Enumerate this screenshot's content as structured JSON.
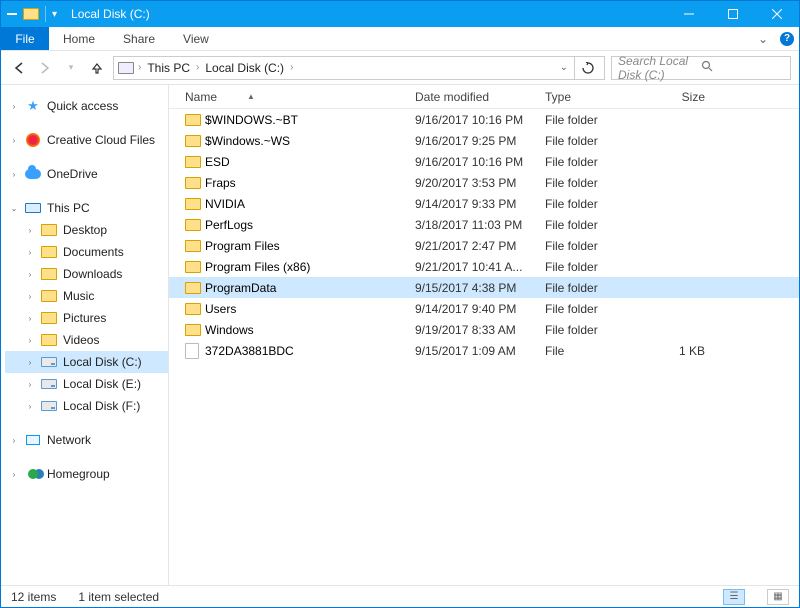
{
  "window": {
    "title": "Local Disk (C:)"
  },
  "ribbon": {
    "file": "File",
    "tabs": [
      "Home",
      "Share",
      "View"
    ]
  },
  "breadcrumb": {
    "root": "This PC",
    "current": "Local Disk (C:)"
  },
  "search": {
    "placeholder": "Search Local Disk (C:)"
  },
  "sidebar": {
    "quick_access": "Quick access",
    "creative_cloud": "Creative Cloud Files",
    "onedrive": "OneDrive",
    "this_pc": "This PC",
    "children": [
      {
        "label": "Desktop"
      },
      {
        "label": "Documents"
      },
      {
        "label": "Downloads"
      },
      {
        "label": "Music"
      },
      {
        "label": "Pictures"
      },
      {
        "label": "Videos"
      },
      {
        "label": "Local Disk (C:)",
        "selected": true
      },
      {
        "label": "Local Disk (E:)"
      },
      {
        "label": "Local Disk (F:)"
      }
    ],
    "network": "Network",
    "homegroup": "Homegroup"
  },
  "columns": {
    "name": "Name",
    "date": "Date modified",
    "type": "Type",
    "size": "Size"
  },
  "rows": [
    {
      "name": "$WINDOWS.~BT",
      "date": "9/16/2017 10:16 PM",
      "type": "File folder",
      "size": "",
      "icon": "folder"
    },
    {
      "name": "$Windows.~WS",
      "date": "9/16/2017 9:25 PM",
      "type": "File folder",
      "size": "",
      "icon": "folder"
    },
    {
      "name": "ESD",
      "date": "9/16/2017 10:16 PM",
      "type": "File folder",
      "size": "",
      "icon": "folder"
    },
    {
      "name": "Fraps",
      "date": "9/20/2017 3:53 PM",
      "type": "File folder",
      "size": "",
      "icon": "folder"
    },
    {
      "name": "NVIDIA",
      "date": "9/14/2017 9:33 PM",
      "type": "File folder",
      "size": "",
      "icon": "folder"
    },
    {
      "name": "PerfLogs",
      "date": "3/18/2017 11:03 PM",
      "type": "File folder",
      "size": "",
      "icon": "folder"
    },
    {
      "name": "Program Files",
      "date": "9/21/2017 2:47 PM",
      "type": "File folder",
      "size": "",
      "icon": "folder"
    },
    {
      "name": "Program Files (x86)",
      "date": "9/21/2017 10:41 A...",
      "type": "File folder",
      "size": "",
      "icon": "folder"
    },
    {
      "name": "ProgramData",
      "date": "9/15/2017 4:38 PM",
      "type": "File folder",
      "size": "",
      "icon": "folder",
      "selected": true
    },
    {
      "name": "Users",
      "date": "9/14/2017 9:40 PM",
      "type": "File folder",
      "size": "",
      "icon": "folder"
    },
    {
      "name": "Windows",
      "date": "9/19/2017 8:33 AM",
      "type": "File folder",
      "size": "",
      "icon": "folder"
    },
    {
      "name": "372DA3881BDC",
      "date": "9/15/2017 1:09 AM",
      "type": "File",
      "size": "1 KB",
      "icon": "file"
    }
  ],
  "status": {
    "count": "12 items",
    "selection": "1 item selected"
  }
}
